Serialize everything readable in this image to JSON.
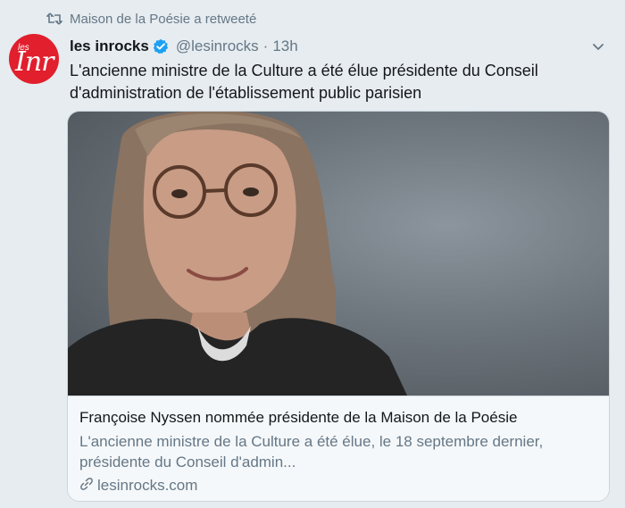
{
  "retweet": {
    "icon": "retweet-icon",
    "text": "Maison de la Poésie a retweeté"
  },
  "author": {
    "avatar_small": "les",
    "avatar_mark": "Inr",
    "name": "les inrocks",
    "verified": true,
    "handle": "@lesinrocks",
    "separator": "·",
    "time": "13h"
  },
  "tweet": {
    "text": "L'ancienne ministre de la Culture a été élue présidente du Conseil\nd'administration de l'établissement public parisien"
  },
  "card": {
    "title": "Françoise Nyssen nommée présidente de la Maison de la Poésie",
    "description": "L'ancienne ministre de la Culture a été élue, le 18 septembre dernier, présidente du Conseil d'admin...",
    "link": "lesinrocks.com",
    "link_icon": "link-icon",
    "image_alt": "portrait photo"
  },
  "colors": {
    "background": "#e6ecf0",
    "secondary_text": "#657786",
    "verified_blue": "#1da1f2",
    "brand_red": "#e11f2d",
    "border": "#ccd6dd"
  }
}
